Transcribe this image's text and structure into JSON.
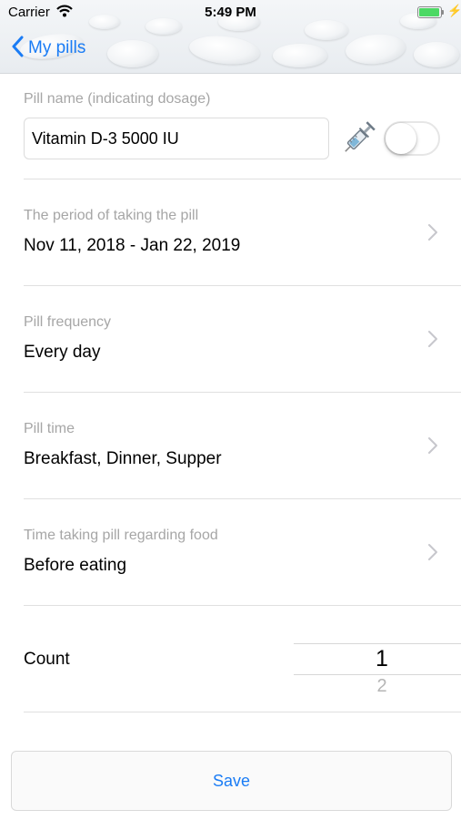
{
  "status_bar": {
    "carrier": "Carrier",
    "time": "5:49 PM"
  },
  "nav": {
    "back_label": "My pills"
  },
  "pill_name": {
    "label": "Pill name (indicating dosage)",
    "value": "Vitamin D-3 5000 IU",
    "injection_toggle_on": false
  },
  "rows": [
    {
      "label": "The period of taking the pill",
      "value": "Nov 11, 2018 - Jan 22, 2019"
    },
    {
      "label": "Pill frequency",
      "value": "Every day"
    },
    {
      "label": "Pill time",
      "value": "Breakfast, Dinner, Supper"
    },
    {
      "label": "Time taking pill regarding food",
      "value": "Before eating"
    }
  ],
  "count": {
    "label": "Count",
    "selected": "1",
    "next": "2"
  },
  "save_label": "Save",
  "colors": {
    "accent": "#1a7cf5",
    "battery": "#4cd964",
    "label_gray": "#a6a6a6"
  },
  "icons": [
    "wifi-icon",
    "battery-icon",
    "charging-bolt-icon",
    "chevron-left-icon",
    "syringe-icon",
    "chevron-right-icon"
  ]
}
